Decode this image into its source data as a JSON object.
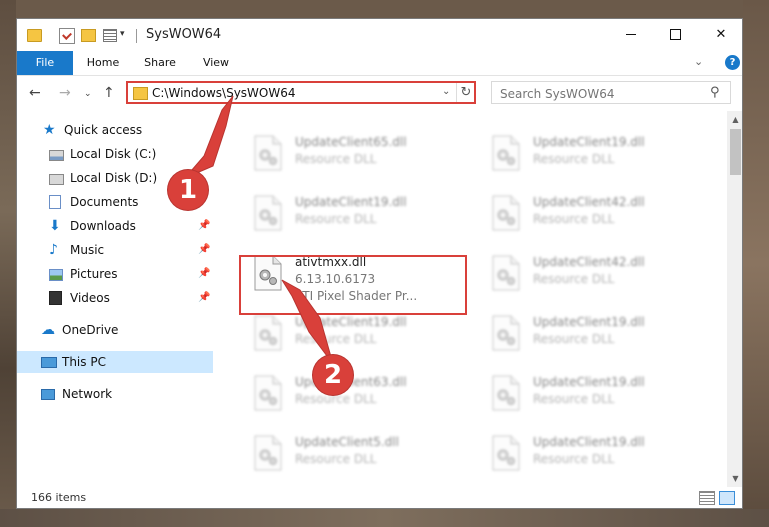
{
  "window": {
    "title": "SysWOW64",
    "qat_dropdown": "▾",
    "minimize": "—",
    "close": "✕"
  },
  "ribbon": {
    "tabs": [
      "File",
      "Home",
      "Share",
      "View"
    ],
    "expand": "⌄",
    "help": "?",
    "accent": "#1979ca"
  },
  "address": {
    "path": "C:\\Windows\\SysWOW64",
    "dropdown": "⌄",
    "refresh": "↻"
  },
  "search": {
    "placeholder": "Search SysWOW64"
  },
  "nav_buttons": {
    "back": "←",
    "forward": "→",
    "recent": "⌄",
    "up": "↑"
  },
  "navpane": {
    "quick_access": "Quick access",
    "local_disk_c": "Local Disk (C:)",
    "local_disk_d": "Local Disk (D:)",
    "documents": "Documents",
    "downloads": "Downloads",
    "music": "Music",
    "pictures": "Pictures",
    "videos": "Videos",
    "onedrive": "OneDrive",
    "this_pc": "This PC",
    "network": "Network",
    "pin": "📌"
  },
  "files": {
    "selected": {
      "name": "ativtmxx.dll",
      "version": "6.13.10.6173",
      "description": "ATI Pixel Shader Pr..."
    },
    "blurred_left": [
      {
        "name": "UpdateClient65.dll",
        "desc": "Resource DLL"
      },
      {
        "name": "UpdateClient19.dll",
        "desc": "Resource DLL"
      },
      {
        "name": "UpdateClient19.dll",
        "desc": "Resource DLL"
      },
      {
        "name": "UpdateClient63.dll",
        "desc": "Resource DLL"
      },
      {
        "name": "UpdateClient5.dll",
        "desc": "Resource DLL"
      }
    ],
    "blurred_right": [
      {
        "name": "UpdateClient19.dll",
        "desc": "Resource DLL"
      },
      {
        "name": "UpdateClient42.dll",
        "desc": "Resource DLL"
      },
      {
        "name": "UpdateClient42.dll",
        "desc": "Resource DLL"
      },
      {
        "name": "UpdateClient19.dll",
        "desc": "Resource DLL"
      },
      {
        "name": "UpdateClient19.dll",
        "desc": "Resource DLL"
      },
      {
        "name": "UpdateClient19.dll",
        "desc": "Resource DLL"
      }
    ]
  },
  "scrollbar": {
    "up": "▲",
    "down": "▼"
  },
  "status": {
    "item_count": "166 items"
  },
  "callouts": {
    "one": "1",
    "two": "2",
    "color": "#d9403a"
  }
}
